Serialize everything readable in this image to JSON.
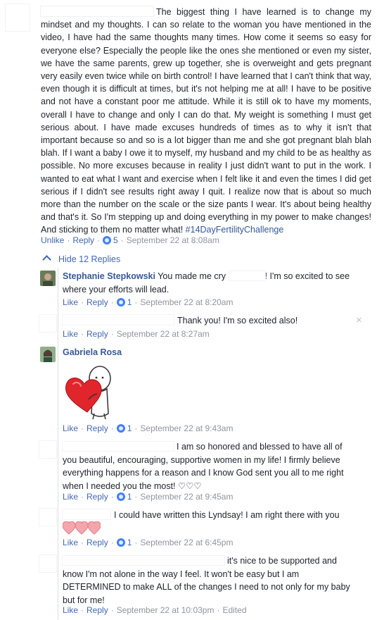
{
  "post": {
    "text": "The biggest thing I have learned is to change my mindset and my thoughts. I can so relate to the woman you have mentioned in the video, I have had the same thoughts many times. How come it seems so easy for everyone else? Especially the people like the ones she mentioned or even my sister, we have the same parents, grew up together, she is overweight and gets pregnant very easily even twice while on birth control! I have learned that I can't think that way, even though it is difficult at times, but it's not helping me at all! I have to be positive and not have a constant poor me attitude. While it is still ok to have my moments, overall I have to change and only I can do that. My weight is something I must get serious about. I have made excuses hundreds of times as to why it isn't that important because so and so is a lot bigger than me and she got pregnant blah blah blah. If I want a baby I owe it to myself, my husband and my child to be as healthy as possible. No more excuses because in reality I just didn't want to put in the work. I wanted to eat what I want and exercise when I felt like it and even the times I did get serious if I didn't see results right away I quit. I realize now that is about so much more than the number on the scale or the size pants I wear. It's about being healthy and that's it. So I'm stepping up and doing everything in my power to make changes! And sticking to them no matter what!",
    "hashtag": "#14DayFertilityChallenge",
    "unlike": "Unlike",
    "reply": "Reply",
    "reaction_count": "5",
    "timestamp": "September 22 at 8:08am"
  },
  "hide_replies": "Hide 12 Replies",
  "replies": [
    {
      "author": "Stephanie Stepkowski",
      "text_a": "You made me cry",
      "text_b": "! I'm so excited to see where your efforts will lead.",
      "like": "Like",
      "reply": "Reply",
      "count": "1",
      "timestamp": "September 22 at 8:20am"
    },
    {
      "text": "Thank you! I'm so excited also!",
      "like": "Like",
      "reply": "Reply",
      "timestamp": "September 22 at 8:27am",
      "close": "×"
    },
    {
      "author": "Gabriela Rosa",
      "like": "Like",
      "reply": "Reply",
      "count": "1",
      "timestamp": "September 22 at 9:43am"
    },
    {
      "text": "I am so honored and blessed to have all of you beautiful, encouraging, supportive women in my life! I firmly believe everything happens for a reason and I know God sent you all to me right when I needed you the most! ♡♡♡",
      "like": "Like",
      "reply": "Reply",
      "count": "1",
      "timestamp": "September 22 at 9:45am"
    },
    {
      "text": "I could have written this Lyndsay! I am right there with you",
      "like": "Like",
      "reply": "Reply",
      "count": "1",
      "timestamp": "September 22 at 6:45pm"
    },
    {
      "text": "it's nice to be supported and know I'm not alone in the way I feel. It won't be easy but I am DETERMINED to make ALL of the changes I need to not only for my baby but for me!",
      "like": "Like",
      "reply": "Reply",
      "timestamp": "September 22 at 10:03pm",
      "edited": "Edited"
    }
  ],
  "colors": {
    "link": "#4267b2",
    "author": "#365899",
    "meta": "#90949c",
    "text": "#1d2129",
    "reaction": "#4080ff",
    "heart": "#f4a6ad"
  }
}
